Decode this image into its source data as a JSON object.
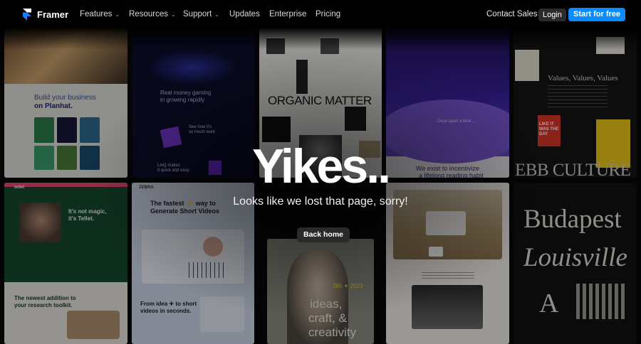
{
  "nav": {
    "logo_text": "Framer",
    "items": [
      {
        "label": "Features",
        "has_dropdown": true
      },
      {
        "label": "Resources",
        "has_dropdown": true
      },
      {
        "label": "Support",
        "has_dropdown": true
      },
      {
        "label": "Updates",
        "has_dropdown": false
      },
      {
        "label": "Enterprise",
        "has_dropdown": false
      },
      {
        "label": "Pricing",
        "has_dropdown": false
      }
    ],
    "contact_label": "Contact Sales",
    "login_label": "Login",
    "start_label": "Start for free",
    "chevron_glyph": "⌄"
  },
  "main": {
    "headline": "Yikes..",
    "subtitle": "Looks like we lost that page, sorry!",
    "back_label": "Back home"
  },
  "colors": {
    "accent": "#0a8cff",
    "background": "#050505",
    "login_bg": "#2c2c2c"
  },
  "background_tiles": {
    "planhat": {
      "line1": "Build your business",
      "line2": "on Planhat."
    },
    "gaming": {
      "title": "Real money gaming",
      "title2": "in growing rapidly",
      "note1": "See how it's",
      "note2": "so much work",
      "note3": "LinQ makes",
      "note4": "it quick and easy"
    },
    "organic": {
      "title": "ORGANIC MATTER"
    },
    "story": {
      "caption1": "Once upon a time...",
      "tagline1": "We exist to incentivize",
      "tagline2": "a lifelong reading habit"
    },
    "values": {
      "title": "Values, Values, Values",
      "big": "EBB CULTURE",
      "poster": "LIKE IT WAS THE DAY"
    },
    "tellet": {
      "brand": "tellet",
      "headline1": "It's not magic,",
      "headline2": "it's Tellet.",
      "bottom1": "The newest addition to",
      "bottom2": "your research toolkit."
    },
    "video": {
      "brand": "ZEBRA",
      "title1": "The fastest ⚡ way to",
      "title2": "Generate Short Videos",
      "bottom1": "From idea ✈ to short",
      "bottom2": "videos in seconds."
    },
    "portrait": {
      "line1": "ideas,",
      "line2": "craft, &",
      "line3": "creativity",
      "tag": "365 ✦ 2023"
    },
    "cities": {
      "city1": "Budapest",
      "city2": "Louisville",
      "letter": "A"
    }
  }
}
